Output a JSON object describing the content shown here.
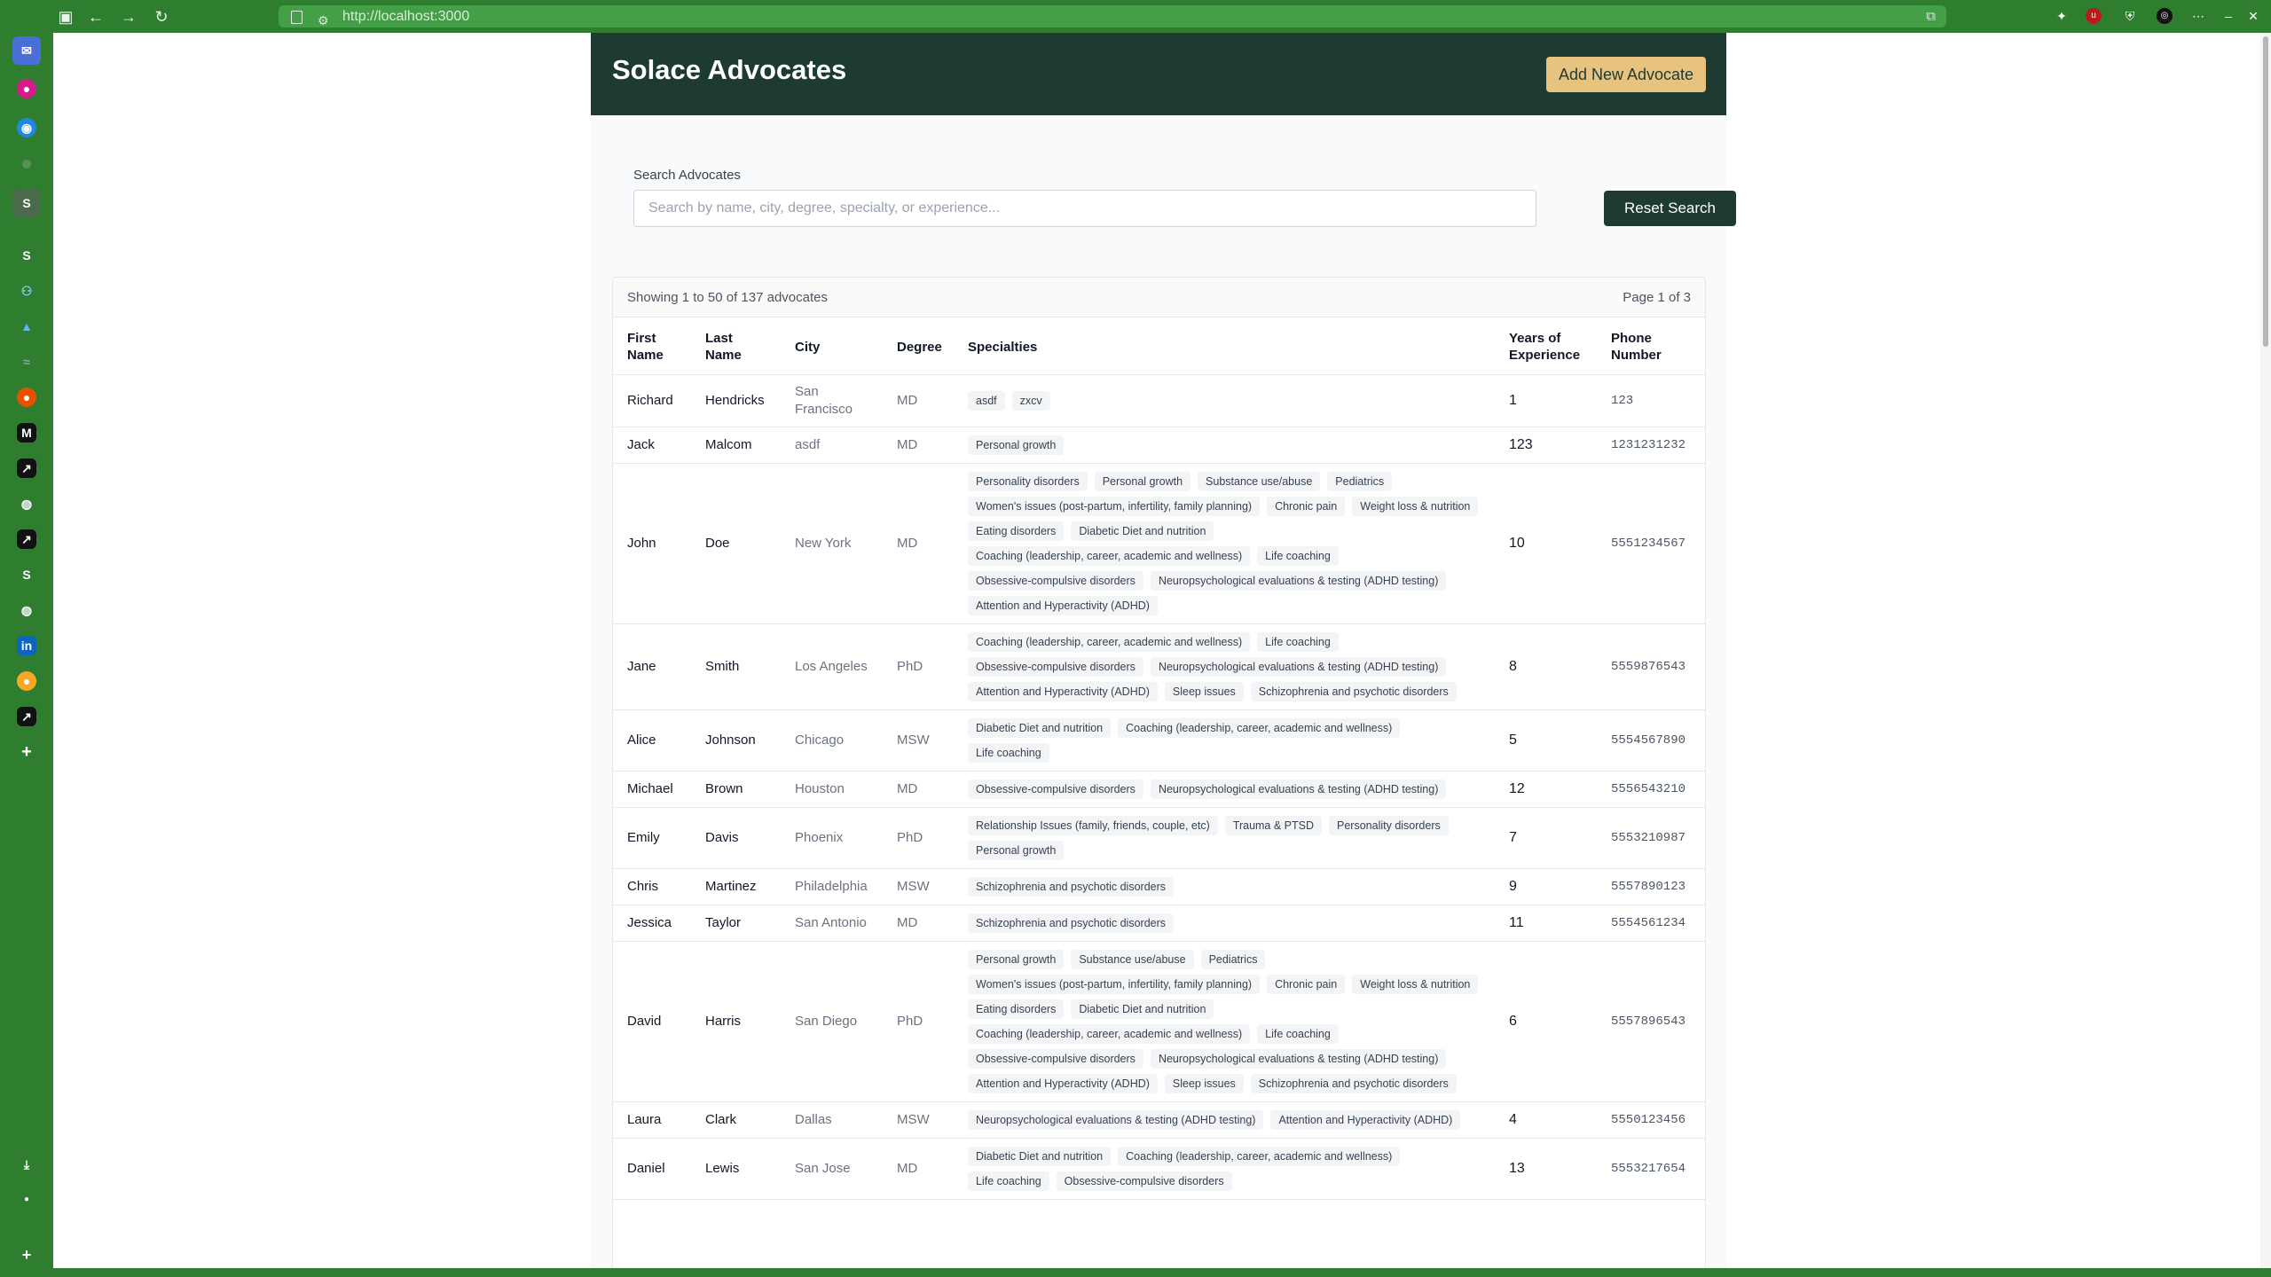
{
  "browser": {
    "url": "http://localhost:3000"
  },
  "app": {
    "title": "Solace Advocates",
    "add_button": "Add New Advocate",
    "search_label": "Search Advocates",
    "search_placeholder": "Search by name, city, degree, specialty, or experience...",
    "search_value": "",
    "reset_button": "Reset Search",
    "showing": "Showing 1 to 50 of 137 advocates",
    "page_info": "Page 1 of 3"
  },
  "columns": [
    "First Name",
    "Last Name",
    "City",
    "Degree",
    "Specialties",
    "Years of Experience",
    "Phone Number"
  ],
  "rows": [
    {
      "first": "Richard",
      "last": "Hendricks",
      "city": "San Francisco",
      "degree": "MD",
      "specialties": [
        "asdf",
        "zxcv"
      ],
      "years": "1",
      "phone": "123"
    },
    {
      "first": "Jack",
      "last": "Malcom",
      "city": "asdf",
      "degree": "MD",
      "specialties": [
        "Personal growth"
      ],
      "years": "123",
      "phone": "1231231232"
    },
    {
      "first": "John",
      "last": "Doe",
      "city": "New York",
      "degree": "MD",
      "specialties": [
        "Personality disorders",
        "Personal growth",
        "Substance use/abuse",
        "Pediatrics",
        "Women's issues (post-partum, infertility, family planning)",
        "Chronic pain",
        "Weight loss & nutrition",
        "Eating disorders",
        "Diabetic Diet and nutrition",
        "Coaching (leadership, career, academic and wellness)",
        "Life coaching",
        "Obsessive-compulsive disorders",
        "Neuropsychological evaluations & testing (ADHD testing)",
        "Attention and Hyperactivity (ADHD)"
      ],
      "years": "10",
      "phone": "5551234567"
    },
    {
      "first": "Jane",
      "last": "Smith",
      "city": "Los Angeles",
      "degree": "PhD",
      "specialties": [
        "Coaching (leadership, career, academic and wellness)",
        "Life coaching",
        "Obsessive-compulsive disorders",
        "Neuropsychological evaluations & testing (ADHD testing)",
        "Attention and Hyperactivity (ADHD)",
        "Sleep issues",
        "Schizophrenia and psychotic disorders"
      ],
      "years": "8",
      "phone": "5559876543"
    },
    {
      "first": "Alice",
      "last": "Johnson",
      "city": "Chicago",
      "degree": "MSW",
      "specialties": [
        "Diabetic Diet and nutrition",
        "Coaching (leadership, career, academic and wellness)",
        "Life coaching"
      ],
      "years": "5",
      "phone": "5554567890"
    },
    {
      "first": "Michael",
      "last": "Brown",
      "city": "Houston",
      "degree": "MD",
      "specialties": [
        "Obsessive-compulsive disorders",
        "Neuropsychological evaluations & testing (ADHD testing)"
      ],
      "years": "12",
      "phone": "5556543210"
    },
    {
      "first": "Emily",
      "last": "Davis",
      "city": "Phoenix",
      "degree": "PhD",
      "specialties": [
        "Relationship Issues (family, friends, couple, etc)",
        "Trauma & PTSD",
        "Personality disorders",
        "Personal growth"
      ],
      "years": "7",
      "phone": "5553210987"
    },
    {
      "first": "Chris",
      "last": "Martinez",
      "city": "Philadelphia",
      "degree": "MSW",
      "specialties": [
        "Schizophrenia and psychotic disorders"
      ],
      "years": "9",
      "phone": "5557890123"
    },
    {
      "first": "Jessica",
      "last": "Taylor",
      "city": "San Antonio",
      "degree": "MD",
      "specialties": [
        "Schizophrenia and psychotic disorders"
      ],
      "years": "11",
      "phone": "5554561234"
    },
    {
      "first": "David",
      "last": "Harris",
      "city": "San Diego",
      "degree": "PhD",
      "specialties": [
        "Personal growth",
        "Substance use/abuse",
        "Pediatrics",
        "Women's issues (post-partum, infertility, family planning)",
        "Chronic pain",
        "Weight loss & nutrition",
        "Eating disorders",
        "Diabetic Diet and nutrition",
        "Coaching (leadership, career, academic and wellness)",
        "Life coaching",
        "Obsessive-compulsive disorders",
        "Neuropsychological evaluations & testing (ADHD testing)",
        "Attention and Hyperactivity (ADHD)",
        "Sleep issues",
        "Schizophrenia and psychotic disorders"
      ],
      "years": "6",
      "phone": "5557896543"
    },
    {
      "first": "Laura",
      "last": "Clark",
      "city": "Dallas",
      "degree": "MSW",
      "specialties": [
        "Neuropsychological evaluations & testing (ADHD testing)",
        "Attention and Hyperactivity (ADHD)"
      ],
      "years": "4",
      "phone": "5550123456"
    },
    {
      "first": "Daniel",
      "last": "Lewis",
      "city": "San Jose",
      "degree": "MD",
      "specialties": [
        "Diabetic Diet and nutrition",
        "Coaching (leadership, career, academic and wellness)",
        "Life coaching",
        "Obsessive-compulsive disorders"
      ],
      "years": "13",
      "phone": "5553217654"
    }
  ]
}
